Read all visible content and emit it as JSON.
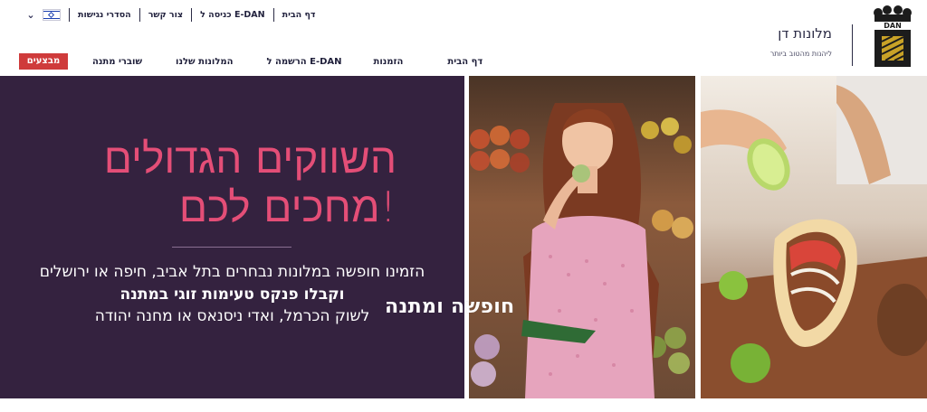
{
  "utility_bar": {
    "language_flag": "israel-flag-icon",
    "links": [
      "הסדרי נגישות",
      "צור קשר",
      "כניסה ל E-DAN",
      "דף הבית"
    ]
  },
  "nav": {
    "deals_button": "מבצעים",
    "items": [
      "שוברי מתנה",
      "המלונות שלנו",
      "הרשמה ל E-DAN",
      "הזמנות",
      "דף הבית"
    ]
  },
  "brand": {
    "name": "מלונות דן",
    "tagline": "ליהנות מהטוב ביותר",
    "logo_text": "DAN"
  },
  "hero": {
    "headline_line1": "השווקים הגדולים",
    "headline_line2": "מחכים לכם!",
    "body_line1": "הזמינו חופשה במלונות נבחרים בתל אביב, חיפה או ירושלים",
    "body_line2": "וקבלו פנקס טעימות זוגי במתנה",
    "body_line3": "לשוק הכרמל, ואדי ניסנאס או מחנה יהודה",
    "overlay_title": "חופשה ומתנה"
  },
  "colors": {
    "headline": "#e44e77",
    "panel_background": "#34223f",
    "deals_button": "#cf3b3b",
    "text_dark": "#2b2b45"
  }
}
